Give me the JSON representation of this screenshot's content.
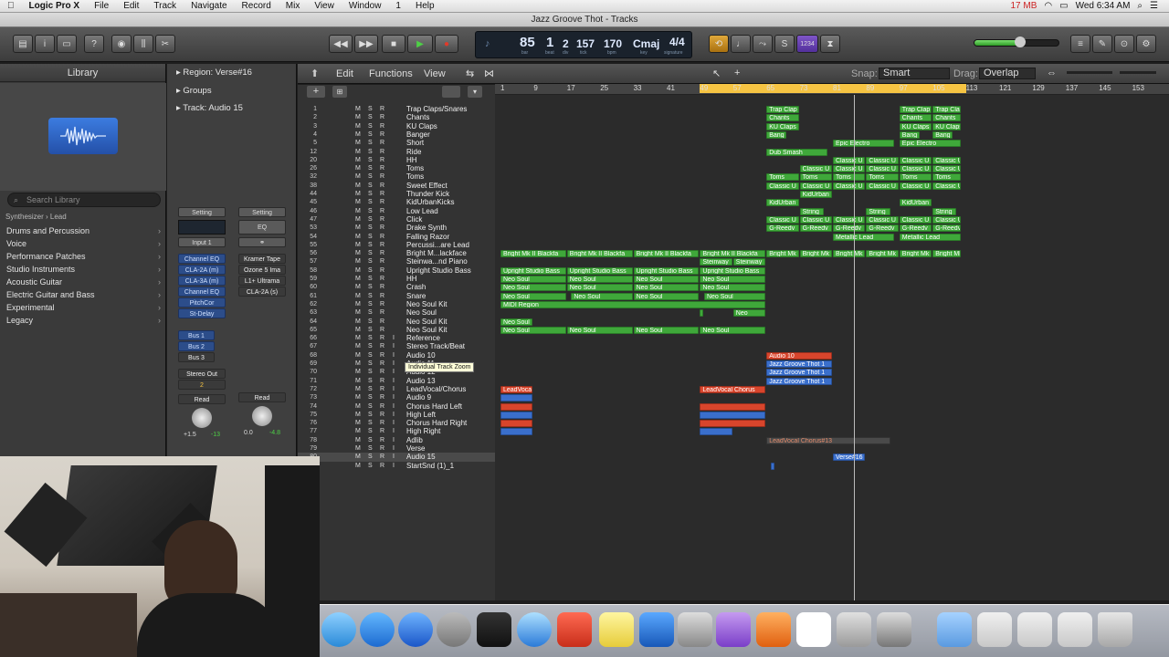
{
  "menubar": {
    "app": "Logic Pro X",
    "items": [
      "File",
      "Edit",
      "Track",
      "Navigate",
      "Record",
      "Mix",
      "View",
      "Window",
      "1",
      "Help"
    ],
    "memory": "17 MB",
    "clock": "Wed 6:34 AM"
  },
  "window_title": "Jazz Groove Thot - Tracks",
  "transport": {
    "bar": "85",
    "beat": "1",
    "div": "2",
    "tick": "157",
    "bar_label": "bar",
    "beat_label": "beat",
    "div_label": "div",
    "tick_label": "tick",
    "bpm": "170",
    "bpm_label": "bpm",
    "key": "Cmaj",
    "key_label": "key",
    "signature": "4/4",
    "signature_label": "signature",
    "count_in": "1234"
  },
  "library": {
    "title": "Library",
    "search_placeholder": "Search Library",
    "breadcrumb": "Synthesizer  ›  Lead",
    "categories": [
      "Drums and Percussion",
      "Voice",
      "Performance Patches",
      "Studio Instruments",
      "Acoustic Guitar",
      "Electric Guitar and Bass",
      "Experimental",
      "Legacy"
    ]
  },
  "inspector": {
    "region": "Region: Verse#16",
    "groups": "Groups",
    "track": "Track:  Audio 15",
    "strip1": {
      "setting": "Setting",
      "input": "Input 1",
      "plugins": [
        "Channel EQ",
        "CLA-2A (m)",
        "CLA-3A (m)",
        "Channel EQ",
        "PitchCor",
        "St-Delay"
      ],
      "sends": [
        "Bus 1",
        "Bus 2",
        "Bus 3"
      ],
      "output": "Stereo Out",
      "group": "2",
      "mode": "Read",
      "pan": "+1.5",
      "db": "-13"
    },
    "strip2": {
      "setting": "Setting",
      "eq": "EQ",
      "plugins": [
        "Kramer Tape",
        "Ozone 5 Ima",
        "L1+ Ultrama",
        "CLA-2A (s)"
      ],
      "mode": "Read",
      "pan": "0.0",
      "db": "-4.8"
    }
  },
  "tracks_toolbar": {
    "edit": "Edit",
    "functions": "Functions",
    "view": "View",
    "snap_label": "Snap:",
    "snap_value": "Smart",
    "drag_label": "Drag:",
    "drag_value": "Overlap"
  },
  "ruler": [
    "1",
    "9",
    "17",
    "25",
    "33",
    "41",
    "49",
    "57",
    "65",
    "73",
    "81",
    "89",
    "97",
    "105",
    "113",
    "121",
    "129",
    "137",
    "145",
    "153"
  ],
  "tooltip": "Individual Track Zoom",
  "tracks": [
    {
      "n": "1",
      "name": "Trap Claps/Snares"
    },
    {
      "n": "2",
      "name": "Chants"
    },
    {
      "n": "3",
      "name": "KU Claps"
    },
    {
      "n": "4",
      "name": "Banger"
    },
    {
      "n": "5",
      "name": "Short"
    },
    {
      "n": "12",
      "name": "Ride"
    },
    {
      "n": "20",
      "name": "HH"
    },
    {
      "n": "26",
      "name": "Toms"
    },
    {
      "n": "32",
      "name": "Toms"
    },
    {
      "n": "38",
      "name": "Sweet Effect"
    },
    {
      "n": "44",
      "name": "Thunder Kick"
    },
    {
      "n": "45",
      "name": "KidUrbanKicks"
    },
    {
      "n": "46",
      "name": "Low Lead"
    },
    {
      "n": "47",
      "name": "Click"
    },
    {
      "n": "53",
      "name": "Drake Synth"
    },
    {
      "n": "54",
      "name": "Falling Razor"
    },
    {
      "n": "55",
      "name": "Percussi...are Lead"
    },
    {
      "n": "56",
      "name": "Bright M...lackface"
    },
    {
      "n": "57",
      "name": "Steinwa...nd Piano"
    },
    {
      "n": "58",
      "name": "Upright Studio Bass"
    },
    {
      "n": "59",
      "name": "HH"
    },
    {
      "n": "60",
      "name": "Crash"
    },
    {
      "n": "61",
      "name": "Snare"
    },
    {
      "n": "62",
      "name": "Neo Soul Kit"
    },
    {
      "n": "63",
      "name": "Neo Soul"
    },
    {
      "n": "64",
      "name": "Neo Soul Kit"
    },
    {
      "n": "65",
      "name": "Neo Soul Kit"
    },
    {
      "n": "66",
      "name": "Reference"
    },
    {
      "n": "67",
      "name": "Stereo Track/Beat"
    },
    {
      "n": "68",
      "name": "Audio 10"
    },
    {
      "n": "69",
      "name": "Audio 11"
    },
    {
      "n": "70",
      "name": "Audio 12"
    },
    {
      "n": "71",
      "name": "Audio 13"
    },
    {
      "n": "72",
      "name": "LeadVocal/Chorus"
    },
    {
      "n": "73",
      "name": "Audio 9"
    },
    {
      "n": "74",
      "name": "Chorus Hard Left"
    },
    {
      "n": "75",
      "name": "High Left"
    },
    {
      "n": "76",
      "name": "Chorus Hard Right"
    },
    {
      "n": "77",
      "name": "High Right"
    },
    {
      "n": "78",
      "name": "Adlib"
    },
    {
      "n": "79",
      "name": "Verse"
    },
    {
      "n": "80",
      "name": "Audio 15"
    },
    {
      "n": "81",
      "name": "StartSnd (1)_1"
    }
  ],
  "track_buttons": {
    "m": "M",
    "s": "S",
    "r": "R",
    "i": "I"
  },
  "regions": [
    {
      "row": 0,
      "bar": 65,
      "len": 8,
      "c": "g",
      "t": "Trap Clap"
    },
    {
      "row": 0,
      "bar": 97,
      "len": 8,
      "c": "g",
      "t": "Trap Clap"
    },
    {
      "row": 0,
      "bar": 105,
      "len": 7,
      "c": "g",
      "t": "Trap Clap"
    },
    {
      "row": 1,
      "bar": 65,
      "len": 8,
      "c": "g",
      "t": "Chants"
    },
    {
      "row": 1,
      "bar": 97,
      "len": 8,
      "c": "g",
      "t": "Chants"
    },
    {
      "row": 1,
      "bar": 105,
      "len": 7,
      "c": "g",
      "t": "Chants"
    },
    {
      "row": 2,
      "bar": 65,
      "len": 8,
      "c": "g",
      "t": "KU Claps"
    },
    {
      "row": 2,
      "bar": 97,
      "len": 8,
      "c": "g",
      "t": "KU Claps"
    },
    {
      "row": 2,
      "bar": 105,
      "len": 7,
      "c": "g",
      "t": "KU Claps"
    },
    {
      "row": 3,
      "bar": 65,
      "len": 5,
      "c": "g",
      "t": "Bang"
    },
    {
      "row": 3,
      "bar": 97,
      "len": 5,
      "c": "g",
      "t": "Bang"
    },
    {
      "row": 3,
      "bar": 105,
      "len": 5,
      "c": "g",
      "t": "Bang"
    },
    {
      "row": 4,
      "bar": 81,
      "len": 15,
      "c": "g",
      "t": "Epic Electro"
    },
    {
      "row": 4,
      "bar": 97,
      "len": 15,
      "c": "g",
      "t": "Epic Electro"
    },
    {
      "row": 5,
      "bar": 65,
      "len": 15,
      "c": "g",
      "t": "Dub Smash"
    },
    {
      "row": 6,
      "bar": 81,
      "len": 8,
      "c": "g",
      "t": "Classic U"
    },
    {
      "row": 6,
      "bar": 89,
      "len": 8,
      "c": "g",
      "t": "Classic U"
    },
    {
      "row": 6,
      "bar": 97,
      "len": 8,
      "c": "g",
      "t": "Classic U"
    },
    {
      "row": 6,
      "bar": 105,
      "len": 7,
      "c": "g",
      "t": "Classic U"
    },
    {
      "row": 7,
      "bar": 73,
      "len": 8,
      "c": "g",
      "t": "Classic U"
    },
    {
      "row": 7,
      "bar": 81,
      "len": 8,
      "c": "g",
      "t": "Classic U"
    },
    {
      "row": 7,
      "bar": 89,
      "len": 8,
      "c": "g",
      "t": "Classic U"
    },
    {
      "row": 7,
      "bar": 97,
      "len": 8,
      "c": "g",
      "t": "Classic U"
    },
    {
      "row": 7,
      "bar": 105,
      "len": 7,
      "c": "g",
      "t": "Classic U"
    },
    {
      "row": 8,
      "bar": 65,
      "len": 8,
      "c": "g",
      "t": "Toms"
    },
    {
      "row": 8,
      "bar": 73,
      "len": 8,
      "c": "g",
      "t": "Toms"
    },
    {
      "row": 8,
      "bar": 81,
      "len": 8,
      "c": "g",
      "t": "Toms"
    },
    {
      "row": 8,
      "bar": 89,
      "len": 8,
      "c": "g",
      "t": "Toms"
    },
    {
      "row": 8,
      "bar": 97,
      "len": 8,
      "c": "g",
      "t": "Toms"
    },
    {
      "row": 8,
      "bar": 105,
      "len": 7,
      "c": "g",
      "t": "Toms"
    },
    {
      "row": 9,
      "bar": 65,
      "len": 8,
      "c": "g",
      "t": "Classic U"
    },
    {
      "row": 9,
      "bar": 73,
      "len": 8,
      "c": "g",
      "t": "Classic U"
    },
    {
      "row": 9,
      "bar": 81,
      "len": 8,
      "c": "g",
      "t": "Classic U"
    },
    {
      "row": 9,
      "bar": 89,
      "len": 8,
      "c": "g",
      "t": "Classic U"
    },
    {
      "row": 9,
      "bar": 97,
      "len": 8,
      "c": "g",
      "t": "Classic U"
    },
    {
      "row": 9,
      "bar": 105,
      "len": 7,
      "c": "g",
      "t": "Classic U"
    },
    {
      "row": 10,
      "bar": 73,
      "len": 8,
      "c": "g",
      "t": "KidUrban"
    },
    {
      "row": 11,
      "bar": 65,
      "len": 8,
      "c": "g",
      "t": "KidUrban"
    },
    {
      "row": 11,
      "bar": 97,
      "len": 8,
      "c": "g",
      "t": "KidUrban"
    },
    {
      "row": 12,
      "bar": 73,
      "len": 6,
      "c": "g",
      "t": "String"
    },
    {
      "row": 12,
      "bar": 89,
      "len": 6,
      "c": "g",
      "t": "String"
    },
    {
      "row": 12,
      "bar": 105,
      "len": 6,
      "c": "g",
      "t": "String"
    },
    {
      "row": 13,
      "bar": 65,
      "len": 8,
      "c": "g",
      "t": "Classic U"
    },
    {
      "row": 13,
      "bar": 73,
      "len": 8,
      "c": "g",
      "t": "Classic U"
    },
    {
      "row": 13,
      "bar": 81,
      "len": 8,
      "c": "g",
      "t": "Classic U"
    },
    {
      "row": 13,
      "bar": 89,
      "len": 8,
      "c": "g",
      "t": "Classic U"
    },
    {
      "row": 13,
      "bar": 97,
      "len": 8,
      "c": "g",
      "t": "Classic U"
    },
    {
      "row": 13,
      "bar": 105,
      "len": 7,
      "c": "g",
      "t": "Classic U"
    },
    {
      "row": 14,
      "bar": 65,
      "len": 8,
      "c": "g",
      "t": "G-Reedv"
    },
    {
      "row": 14,
      "bar": 73,
      "len": 8,
      "c": "g",
      "t": "G-Reedv"
    },
    {
      "row": 14,
      "bar": 81,
      "len": 8,
      "c": "g",
      "t": "G-Reedv"
    },
    {
      "row": 14,
      "bar": 89,
      "len": 8,
      "c": "g",
      "t": "G-Reedv"
    },
    {
      "row": 14,
      "bar": 97,
      "len": 8,
      "c": "g",
      "t": "G-Reedv"
    },
    {
      "row": 14,
      "bar": 105,
      "len": 7,
      "c": "g",
      "t": "G-Reedv"
    },
    {
      "row": 15,
      "bar": 81,
      "len": 15,
      "c": "g",
      "t": "Metallic Lead"
    },
    {
      "row": 15,
      "bar": 97,
      "len": 15,
      "c": "g",
      "t": "Metallic Lead"
    },
    {
      "row": 17,
      "bar": 1,
      "len": 16,
      "c": "g",
      "t": "Bright Mk II Blackfa"
    },
    {
      "row": 17,
      "bar": 17,
      "len": 16,
      "c": "g",
      "t": "Bright Mk II Blackfa"
    },
    {
      "row": 17,
      "bar": 33,
      "len": 16,
      "c": "g",
      "t": "Bright Mk II Blackfa"
    },
    {
      "row": 17,
      "bar": 49,
      "len": 16,
      "c": "g",
      "t": "Bright Mk II Blackfa"
    },
    {
      "row": 17,
      "bar": 65,
      "len": 8,
      "c": "g",
      "t": "Bright Mk"
    },
    {
      "row": 17,
      "bar": 73,
      "len": 8,
      "c": "g",
      "t": "Bright Mk"
    },
    {
      "row": 17,
      "bar": 81,
      "len": 8,
      "c": "g",
      "t": "Bright Mk"
    },
    {
      "row": 17,
      "bar": 89,
      "len": 8,
      "c": "g",
      "t": "Bright Mk"
    },
    {
      "row": 17,
      "bar": 97,
      "len": 8,
      "c": "g",
      "t": "Bright Mk"
    },
    {
      "row": 17,
      "bar": 105,
      "len": 7,
      "c": "g",
      "t": "Bright Mk"
    },
    {
      "row": 18,
      "bar": 49,
      "len": 8,
      "c": "g",
      "t": "Steinway"
    },
    {
      "row": 18,
      "bar": 57,
      "len": 8,
      "c": "g",
      "t": "Steinway"
    },
    {
      "row": 19,
      "bar": 1,
      "len": 16,
      "c": "g",
      "t": "Upright Studio Bass"
    },
    {
      "row": 19,
      "bar": 17,
      "len": 16,
      "c": "g",
      "t": "Upright Studio Bass"
    },
    {
      "row": 19,
      "bar": 33,
      "len": 16,
      "c": "g",
      "t": "Upright Studio Bass"
    },
    {
      "row": 19,
      "bar": 49,
      "len": 16,
      "c": "g",
      "t": "Upright Studio Bass"
    },
    {
      "row": 20,
      "bar": 1,
      "len": 16,
      "c": "g",
      "t": "Neo Soul"
    },
    {
      "row": 20,
      "bar": 17,
      "len": 16,
      "c": "g",
      "t": "Neo Soul"
    },
    {
      "row": 20,
      "bar": 33,
      "len": 16,
      "c": "g",
      "t": "Neo Soul"
    },
    {
      "row": 20,
      "bar": 49,
      "len": 16,
      "c": "g",
      "t": "Neo Soul"
    },
    {
      "row": 21,
      "bar": 1,
      "len": 16,
      "c": "g",
      "t": "Neo Soul"
    },
    {
      "row": 21,
      "bar": 17,
      "len": 16,
      "c": "g",
      "t": "Neo Soul"
    },
    {
      "row": 21,
      "bar": 33,
      "len": 16,
      "c": "g",
      "t": "Neo Soul"
    },
    {
      "row": 21,
      "bar": 49,
      "len": 16,
      "c": "g",
      "t": "Neo Soul"
    },
    {
      "row": 22,
      "bar": 1,
      "len": 16,
      "c": "g",
      "t": "Neo Soul"
    },
    {
      "row": 22,
      "bar": 18,
      "len": 15,
      "c": "g",
      "t": "Neo Soul"
    },
    {
      "row": 22,
      "bar": 33,
      "len": 16,
      "c": "g",
      "t": "Neo Soul"
    },
    {
      "row": 22,
      "bar": 50,
      "len": 15,
      "c": "g",
      "t": "Neo Soul"
    },
    {
      "row": 23,
      "bar": 1,
      "len": 64,
      "c": "g",
      "t": "MIDI Region"
    },
    {
      "row": 24,
      "bar": 49,
      "len": 1,
      "c": "g",
      "t": ""
    },
    {
      "row": 24,
      "bar": 57,
      "len": 8,
      "c": "g",
      "t": "Neo"
    },
    {
      "row": 25,
      "bar": 1,
      "len": 8,
      "c": "g",
      "t": "Neo Soul"
    },
    {
      "row": 26,
      "bar": 1,
      "len": 16,
      "c": "g",
      "t": "Neo Soul"
    },
    {
      "row": 26,
      "bar": 17,
      "len": 16,
      "c": "g",
      "t": "Neo Soul"
    },
    {
      "row": 26,
      "bar": 33,
      "len": 16,
      "c": "g",
      "t": "Neo Soul"
    },
    {
      "row": 26,
      "bar": 49,
      "len": 16,
      "c": "g",
      "t": "Neo Soul"
    },
    {
      "row": 29,
      "bar": 65,
      "len": 16,
      "c": "r",
      "t": "Audio 10"
    },
    {
      "row": 30,
      "bar": 65,
      "len": 16,
      "c": "b",
      "t": "Jazz Groove Thot 1"
    },
    {
      "row": 31,
      "bar": 65,
      "len": 16,
      "c": "b",
      "t": "Jazz Groove Thot 1"
    },
    {
      "row": 32,
      "bar": 65,
      "len": 16,
      "c": "b",
      "t": "Jazz Groove Thot 1"
    },
    {
      "row": 33,
      "bar": 1,
      "len": 8,
      "c": "r",
      "t": "LeadVoca"
    },
    {
      "row": 33,
      "bar": 49,
      "len": 16,
      "c": "r",
      "t": "LeadVocal Chorus"
    },
    {
      "row": 34,
      "bar": 1,
      "len": 8,
      "c": "b",
      "t": ""
    },
    {
      "row": 35,
      "bar": 1,
      "len": 8,
      "c": "r",
      "t": ""
    },
    {
      "row": 35,
      "bar": 49,
      "len": 16,
      "c": "r",
      "t": ""
    },
    {
      "row": 36,
      "bar": 1,
      "len": 8,
      "c": "b",
      "t": ""
    },
    {
      "row": 36,
      "bar": 49,
      "len": 16,
      "c": "b",
      "t": ""
    },
    {
      "row": 37,
      "bar": 1,
      "len": 8,
      "c": "r",
      "t": ""
    },
    {
      "row": 37,
      "bar": 49,
      "len": 16,
      "c": "r",
      "t": ""
    },
    {
      "row": 38,
      "bar": 1,
      "len": 8,
      "c": "b",
      "t": ""
    },
    {
      "row": 38,
      "bar": 49,
      "len": 8,
      "c": "b",
      "t": ""
    },
    {
      "row": 39,
      "bar": 65,
      "len": 30,
      "c": "gray",
      "t": "LeadVocal Chorus#13"
    },
    {
      "row": 41,
      "bar": 81,
      "len": 8,
      "c": "b",
      "t": "Verse#16"
    },
    {
      "row": 42,
      "bar": 66,
      "len": 1,
      "c": "b",
      "t": "S"
    }
  ],
  "colors": {
    "accent": "#f6c443",
    "midi": "#3fa83a",
    "audio": "#3a6fcc",
    "vocal": "#d8452c"
  }
}
